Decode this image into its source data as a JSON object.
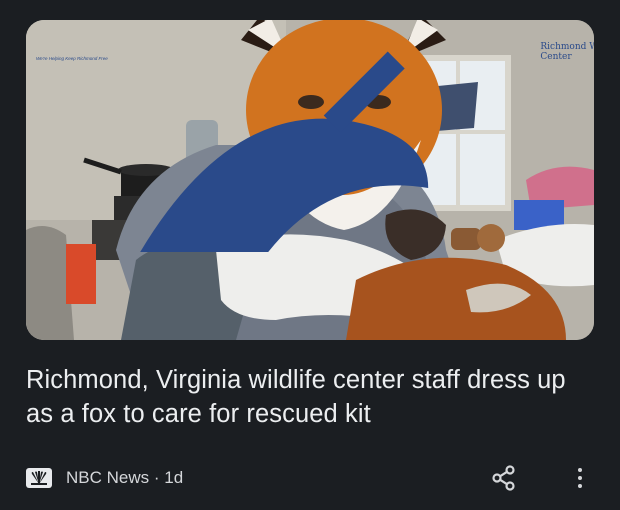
{
  "article": {
    "image_alt_icon": "photo-person-in-fox-mask-feeding-fox-kit",
    "watermark_text": "Richmond Wildlife Center",
    "watermark_sub": "We're Helping Keep Richmond Free",
    "headline": "Richmond, Virginia wildlife center staff dress up as a fox to care for rescued kit",
    "source": "NBC News",
    "age_separator": " · ",
    "age": "1d"
  },
  "icons": {
    "source_logo": "nbc-peacock-icon",
    "share": "share-icon",
    "more": "more-vertical-icon"
  },
  "colors": {
    "background": "#1b1e22",
    "headline_text": "#eceef0",
    "meta_text": "#d5d7da"
  }
}
